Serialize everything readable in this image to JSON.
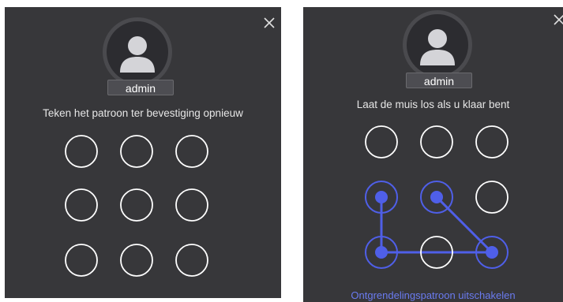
{
  "left_dialog": {
    "username": "admin",
    "instruction": "Teken het patroon ter bevestiging opnieuw",
    "close_icon": "close-icon"
  },
  "right_dialog": {
    "username": "admin",
    "instruction": "Laat de muis los als u klaar bent",
    "disable_link": "Ontgrendelingspatroon uitschakelen",
    "close_icon": "close-icon",
    "pattern_sequence": [
      3,
      6,
      8,
      4
    ],
    "selected_dots": [
      3,
      4,
      6,
      8
    ]
  },
  "colors": {
    "panel_bg": "#37373a",
    "dot_ring": "#ffffff",
    "accent": "#4f5fe8",
    "link": "#6a7bf0"
  }
}
